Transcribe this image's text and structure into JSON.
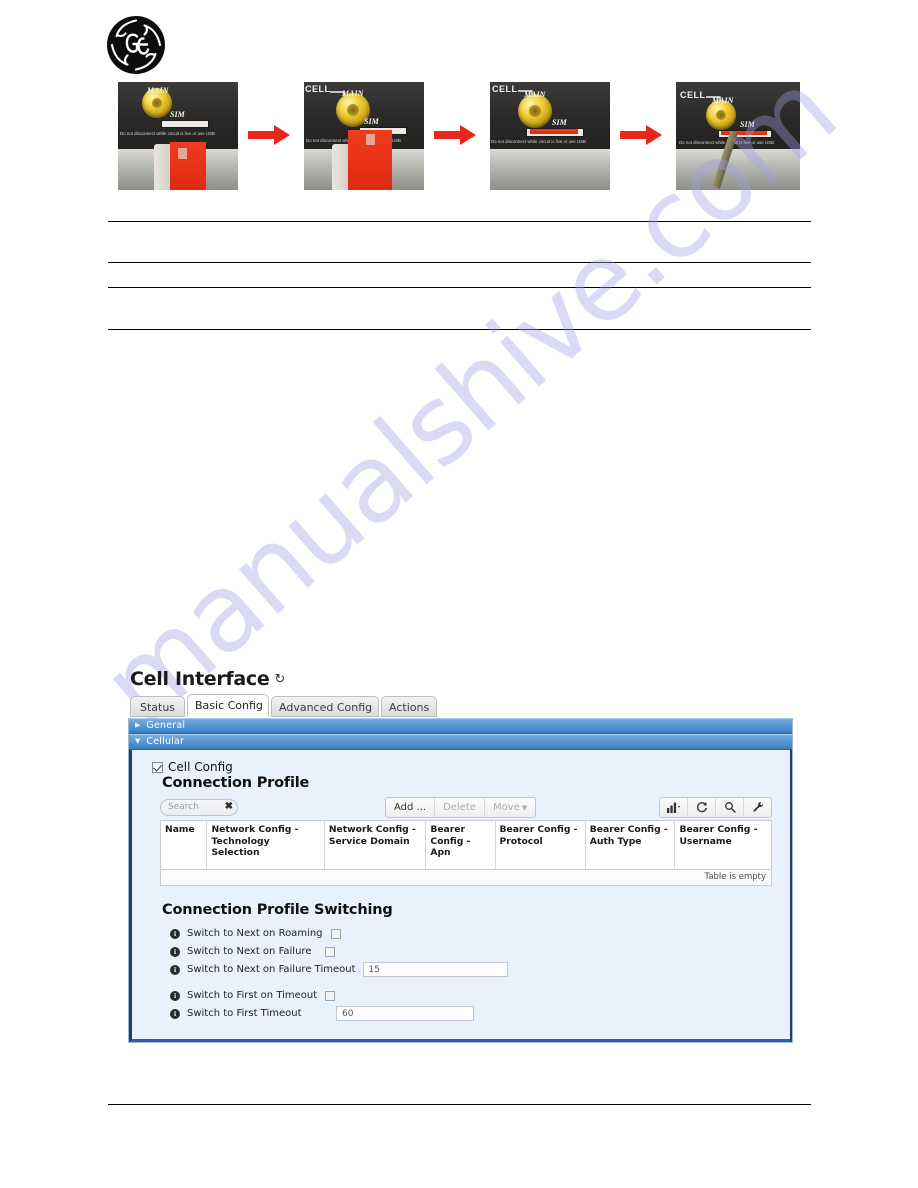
{
  "document": {
    "brand_logo": "ge-monogram-logo",
    "watermark_text": "manualshive.com",
    "rules_count": 5
  },
  "photo_strip": {
    "caption_labels": {
      "cell": "CELL",
      "main": "MAIN",
      "sim": "SIM"
    },
    "warning_text": "Do not disconnect while circuit is live or use USB",
    "steps": [
      {
        "name": "sim-insert-step-1",
        "show_cell_label": false
      },
      {
        "name": "sim-insert-step-2",
        "show_cell_label": true
      },
      {
        "name": "sim-insert-step-3",
        "show_cell_label": true
      },
      {
        "name": "sim-insert-step-4",
        "show_cell_label": true
      }
    ],
    "arrow_color": "#e8261c",
    "arrow_count": 3
  },
  "ui": {
    "page_title": "Cell Interface",
    "refresh_icon": "refresh-icon",
    "tabs": [
      {
        "label": "Status",
        "active": false
      },
      {
        "label": "Basic Config",
        "active": true
      },
      {
        "label": "Advanced Config",
        "active": false
      },
      {
        "label": "Actions",
        "active": false
      }
    ],
    "sections": [
      {
        "label": "General",
        "expanded": false,
        "triangle": "▶"
      },
      {
        "label": "Cellular",
        "expanded": true,
        "triangle": "▼"
      }
    ],
    "cell_config": {
      "label": "Cell Config",
      "checked": true
    },
    "connection_profile": {
      "heading": "Connection Profile",
      "search": {
        "placeholder": "Search",
        "value": "",
        "clear_icon": "✖"
      },
      "buttons": [
        {
          "label": "Add ...",
          "enabled": true
        },
        {
          "label": "Delete",
          "enabled": false
        },
        {
          "label": "Move",
          "enabled": false,
          "has_caret": true
        }
      ],
      "icon_buttons": [
        {
          "name": "chart-icon",
          "glyph": "chart",
          "has_caret": true
        },
        {
          "name": "refresh-icon",
          "glyph": "refresh"
        },
        {
          "name": "search-icon",
          "glyph": "magnifier"
        },
        {
          "name": "wrench-icon",
          "glyph": "wrench"
        }
      ],
      "table": {
        "columns": [
          "Name",
          "Network Config - Technology Selection",
          "Network Config - Service Domain",
          "Bearer Config - Apn",
          "Bearer Config - Protocol",
          "Bearer Config - Auth Type",
          "Bearer Config - Username"
        ],
        "rows": [],
        "empty_message": "Table is empty"
      }
    },
    "connection_profile_switching": {
      "heading": "Connection Profile Switching",
      "fields": [
        {
          "label": "Switch to Next on Roaming",
          "type": "checkbox",
          "checked": false,
          "info": true
        },
        {
          "label": "Switch to Next on Failure",
          "type": "checkbox",
          "checked": false,
          "info": true
        },
        {
          "label": "Switch to Next on Failure Timeout",
          "type": "text",
          "value": "15",
          "info": true
        },
        {
          "label": "Switch to First on Timeout",
          "type": "checkbox",
          "checked": false,
          "info": true,
          "spaced": true
        },
        {
          "label": "Switch to First Timeout",
          "type": "text",
          "value": "60",
          "info": true
        }
      ]
    }
  },
  "colors": {
    "section_bar_top": "#6ba8dd",
    "section_bar_bottom": "#3b7cc0",
    "panel_bg": "#e9f1fd",
    "panel_border": "#1d3f74",
    "arrow_red": "#e8261c",
    "watermark": "#9e9ee2"
  }
}
